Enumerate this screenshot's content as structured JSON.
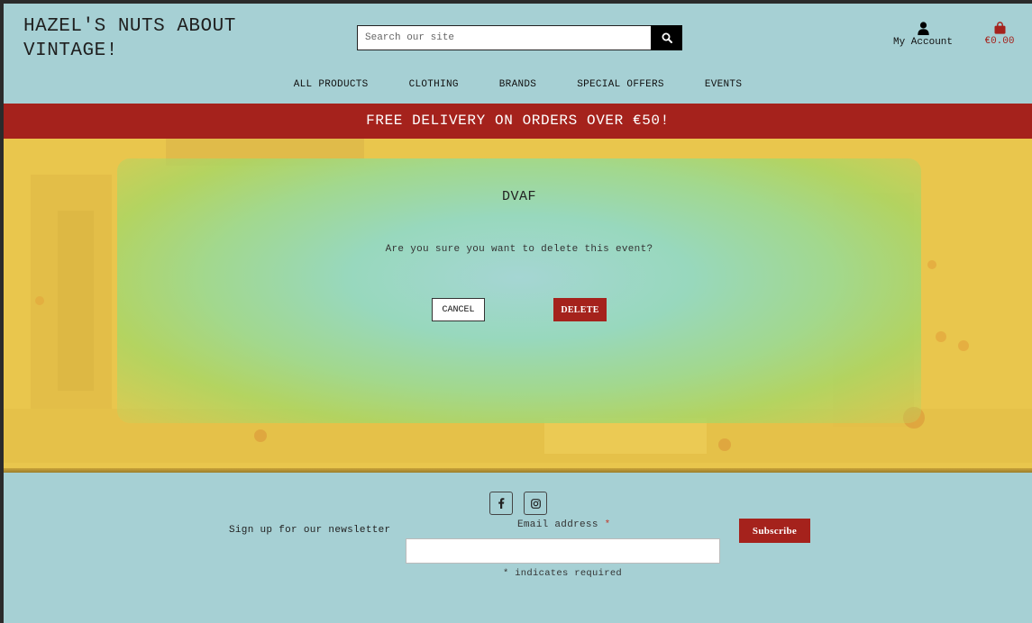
{
  "header": {
    "brand": "HAZEL'S NUTS ABOUT VINTAGE!",
    "search_placeholder": "Search our site",
    "account_label": "My Account",
    "cart_total": "€0.00"
  },
  "nav": {
    "items": [
      "ALL PRODUCTS",
      "CLOTHING",
      "BRANDS",
      "SPECIAL OFFERS",
      "EVENTS"
    ]
  },
  "banner": {
    "text": "FREE DELIVERY ON ORDERS OVER €50!"
  },
  "dialog": {
    "title": "DVAF",
    "message": "Are you sure you want to delete this event?",
    "cancel_label": "CANCEL",
    "delete_label": "DELETE"
  },
  "footer": {
    "newsletter_label": "Sign up for our newsletter",
    "email_label": "Email address",
    "required_marker": "*",
    "required_note": "* indicates required",
    "subscribe_label": "Subscribe"
  },
  "colors": {
    "accent": "#a5221c",
    "background": "#a6d0d4",
    "hero": "#ecc94e"
  },
  "icons": {
    "search": "search-icon",
    "account": "user-icon",
    "cart": "shopping-bag-icon",
    "facebook": "facebook-icon",
    "instagram": "instagram-icon"
  }
}
